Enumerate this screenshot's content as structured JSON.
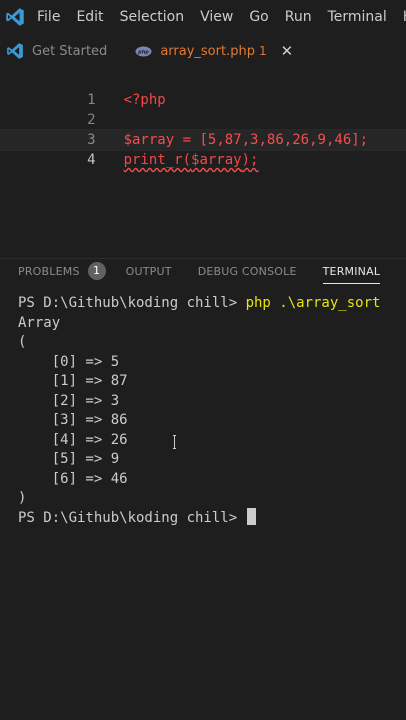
{
  "menu": {
    "items": [
      "File",
      "Edit",
      "Selection",
      "View",
      "Go",
      "Run",
      "Terminal",
      "He"
    ]
  },
  "tabs": {
    "get_started": "Get Started",
    "active_file": "array_sort.php",
    "active_problem_count": "1",
    "close_glyph": "✕"
  },
  "editor": {
    "lines": [
      {
        "num": "1",
        "text": "<?php"
      },
      {
        "num": "2",
        "text": ""
      },
      {
        "num": "3",
        "text": "$array = [5,87,3,86,26,9,46];"
      },
      {
        "num": "4",
        "text": "print_r($array);"
      }
    ]
  },
  "panel": {
    "problems": "PROBLEMS",
    "problems_count": "1",
    "output": "OUTPUT",
    "debug_console": "DEBUG CONSOLE",
    "terminal": "TERMINAL"
  },
  "terminal": {
    "prompt_line": "PS D:\\Github\\koding chill> ",
    "command": "php .\\array_sort",
    "output": [
      "Array",
      "(",
      "    [0] => 5",
      "    [1] => 87",
      "    [2] => 3",
      "    [3] => 86",
      "    [4] => 26",
      "    [5] => 9",
      "    [6] => 46",
      ")"
    ],
    "final_prompt": "PS D:\\Github\\koding chill> "
  },
  "colors": {
    "background": "#1e1e1e",
    "accent_tab": "#e37933",
    "vscode_blue": "#3c99d4",
    "command_yellow": "#e5e510"
  }
}
